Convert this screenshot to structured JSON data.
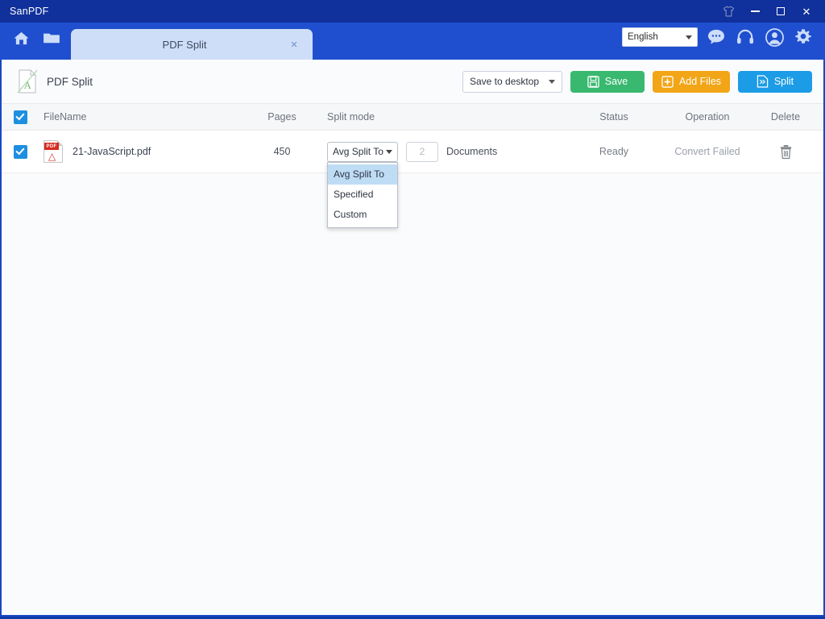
{
  "window": {
    "app_title": "SanPDF",
    "controls": {
      "theme_icon": "tshirt-icon",
      "minimize": "minimize-icon",
      "maximize": "maximize-icon",
      "close": "close-icon"
    }
  },
  "navbar": {
    "home_icon": "home-icon",
    "folder_icon": "folder-icon",
    "tabs": [
      {
        "label": "PDF Split",
        "close": "×",
        "active": true
      }
    ],
    "language": {
      "value": "English",
      "caret": "▾"
    },
    "icons": [
      {
        "name": "chat-icon"
      },
      {
        "name": "headphones-icon"
      },
      {
        "name": "account-icon"
      },
      {
        "name": "settings-gear-icon"
      }
    ]
  },
  "header": {
    "doc_icon": "pdf-split-document-icon",
    "title": "PDF Split"
  },
  "toolbar": {
    "save_location": {
      "value": "Save to desktop",
      "caret": "▾"
    },
    "save_label": "Save",
    "add_files_label": "Add Files",
    "split_label": "Split"
  },
  "table": {
    "columns": [
      {
        "key": "check",
        "label": ""
      },
      {
        "key": "filename",
        "label": "FileName"
      },
      {
        "key": "pages",
        "label": "Pages"
      },
      {
        "key": "splitmode",
        "label": "Split mode"
      },
      {
        "key": "status",
        "label": "Status"
      },
      {
        "key": "operation",
        "label": "Operation"
      },
      {
        "key": "delete",
        "label": "Delete"
      }
    ],
    "header_checkbox_checked": true,
    "rows": [
      {
        "checked": true,
        "file_icon": "pdf-file-icon",
        "filename": "21-JavaScript.pdf",
        "pages": "450",
        "split_mode": {
          "selected": "Avg Split To",
          "open": true,
          "options": [
            {
              "label": "Avg Split To",
              "selected": true
            },
            {
              "label": "Specified",
              "selected": false
            },
            {
              "label": "Custom",
              "selected": false
            }
          ]
        },
        "quantity_placeholder": "2",
        "quantity_unit": "Documents",
        "status": "Ready",
        "operation": "Convert Failed",
        "delete_icon": "trash-icon"
      }
    ]
  },
  "colors": {
    "titlebar": "#10309b",
    "navbar": "#1f4fcf",
    "tab_active": "#cfdef8",
    "content_bg": "#fafbfd",
    "accent_blue": "#1e8fe0",
    "save_green": "#39b96f",
    "add_orange": "#f2a516",
    "split_blue": "#1c9ce6",
    "pdf_red": "#d62b20"
  }
}
